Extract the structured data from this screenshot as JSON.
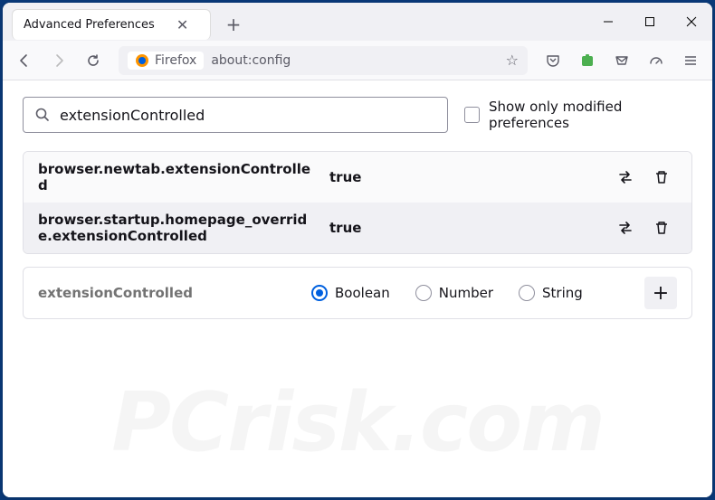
{
  "tab": {
    "title": "Advanced Preferences"
  },
  "urlbar": {
    "identity": "Firefox",
    "url": "about:config"
  },
  "search": {
    "value": "extensionControlled",
    "checkbox_label": "Show only modified preferences"
  },
  "prefs": [
    {
      "name": "browser.newtab.extensionControlled",
      "value": "true"
    },
    {
      "name": "browser.startup.homepage_override.extensionControlled",
      "value": "true"
    }
  ],
  "add": {
    "name": "extensionControlled",
    "types": [
      "Boolean",
      "Number",
      "String"
    ],
    "selected": "Boolean"
  },
  "watermark": "PCrisk.com"
}
